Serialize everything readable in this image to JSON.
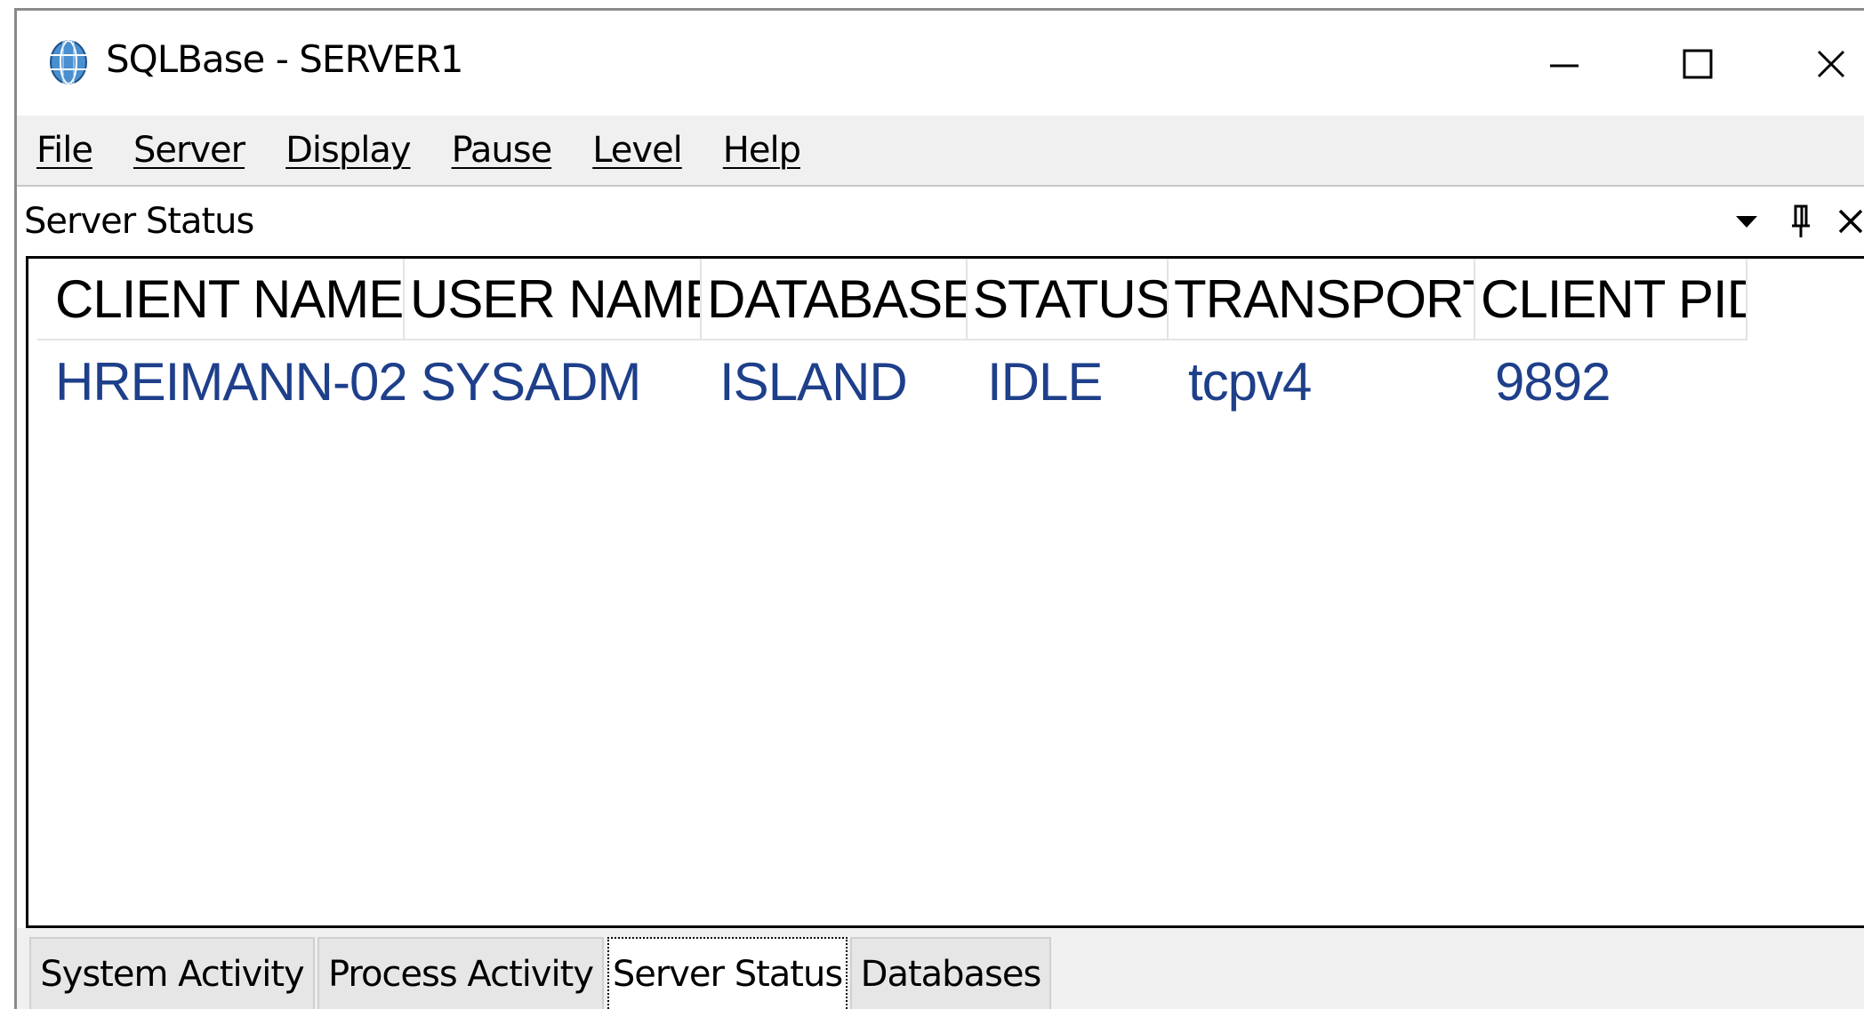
{
  "window": {
    "title": "SQLBase - SERVER1",
    "minimize_icon": "minimize-icon",
    "maximize_icon": "maximize-icon",
    "close_icon": "close-icon"
  },
  "menu": {
    "items": [
      {
        "label": "File"
      },
      {
        "label": "Server"
      },
      {
        "label": "Display"
      },
      {
        "label": "Pause"
      },
      {
        "label": "Level"
      },
      {
        "label": "Help"
      }
    ]
  },
  "panel": {
    "title": "Server Status",
    "icons": [
      "dropdown-arrow-icon",
      "pin-icon",
      "close-icon"
    ]
  },
  "table": {
    "columns": [
      "CLIENT NAME",
      "USER NAME",
      "DATABASE",
      "STATUS",
      "TRANSPORT",
      "CLIENT PID"
    ],
    "rows": [
      [
        "HREIMANN-02",
        "SYSADM",
        "ISLAND",
        "IDLE",
        "tcpv4",
        "9892"
      ]
    ]
  },
  "tabs": {
    "items": [
      {
        "label": "System Activity",
        "active": false
      },
      {
        "label": "Process Activity",
        "active": false
      },
      {
        "label": "Server Status",
        "active": true
      },
      {
        "label": "Databases",
        "active": false
      }
    ]
  },
  "colors": {
    "cell_text": "#1e3f8a",
    "menu_bg": "#f0f0f0",
    "border": "#000000"
  }
}
